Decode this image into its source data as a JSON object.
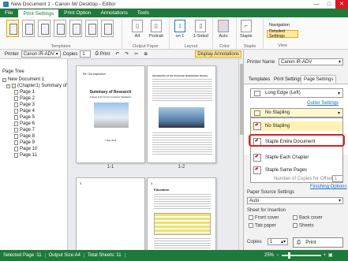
{
  "window": {
    "title": "New Document 1 - Canon iW Desktop - Editor",
    "minimize": "—",
    "maximize": "□",
    "close": "✕"
  },
  "ribbon_tabs": [
    "File",
    "Print Settings",
    "Print Option",
    "Annotations",
    "Tools"
  ],
  "ribbon": {
    "groups": {
      "templates": "Templates",
      "output_paper": "Output Paper",
      "layout": "Layout",
      "color": "Color",
      "staple": "Staple",
      "view": "View"
    },
    "buttons": {
      "paper_size": "A4",
      "orientation": "Portrait",
      "pages_per_sheet": "1",
      "pages_per_sheet_label": "on 1",
      "sides": "1-Sided",
      "color": "Auto",
      "staple": "Staple"
    },
    "view": {
      "navigation": "Navigation",
      "detailed_settings": "Detailed Settings"
    }
  },
  "toolbar": {
    "printer_label": "Printer",
    "printer_value": "Canon iR-ADV",
    "copies_label": "Copies",
    "copies_value": "1",
    "print": "Print",
    "display_annotations": "Display Annotations"
  },
  "sidebar": {
    "title": "Page Tree",
    "doc": "New Document 1",
    "chapter": "(Chapter1) Summary of R",
    "pages": [
      "Page 1",
      "Page 2",
      "Page 3",
      "Page 4",
      "Page 5",
      "Page 6",
      "Page 7",
      "Page 8",
      "Page 9",
      "Page 10",
      "Page 11"
    ]
  },
  "canvas": {
    "captions": [
      "1-1",
      "1-2"
    ],
    "page1": {
      "header": "Re: Old Inspection",
      "title": "Summary of Research",
      "subtitle": "Analysis of the Trend in Customer Satisfaction",
      "footer": "7 May 2014"
    },
    "page2": {
      "header": "Introduction of the Customer Satisfaction Survey"
    },
    "page3": {
      "num": "3"
    },
    "page4": {
      "num": "4",
      "header": "Education"
    }
  },
  "right_panel": {
    "printer_label": "Printer Name",
    "printer_value": "Canon iR-ADV",
    "tabs": [
      "Templates",
      "Print Settings",
      "Page Settings"
    ],
    "binding": "Long Edge (Left)",
    "gutter_link": "Gutter Settings",
    "staple_selected": "No Stapling",
    "staple_options": [
      "No Stapling",
      "Staple Entire Document",
      "Staple Each Chapter",
      "Staple Same Pages"
    ],
    "copies_offset_label": "Number of Copies for Offset",
    "copies_offset_value": "1",
    "finishing_link": "Finishing Options",
    "paper_source_title": "Paper Source Settings",
    "paper_source_value": "Auto",
    "sheet_insertion_title": "Sheet for Insertion",
    "front_cover": "Front cover",
    "back_cover": "Back cover",
    "tab_paper": "Tab paper",
    "sheets": "Sheets",
    "copies_label": "Copies",
    "copies_value": "1",
    "print_button": "Print"
  },
  "status": {
    "selected_page": "Selected Page :11",
    "output_size": "Output Size:A4",
    "total_sheets": "Total Sheets: 11",
    "zoom": "25%"
  },
  "colors": {
    "accent": "#1e7a3a",
    "highlight": "#e0201e",
    "selected": "#ffe9a8"
  }
}
